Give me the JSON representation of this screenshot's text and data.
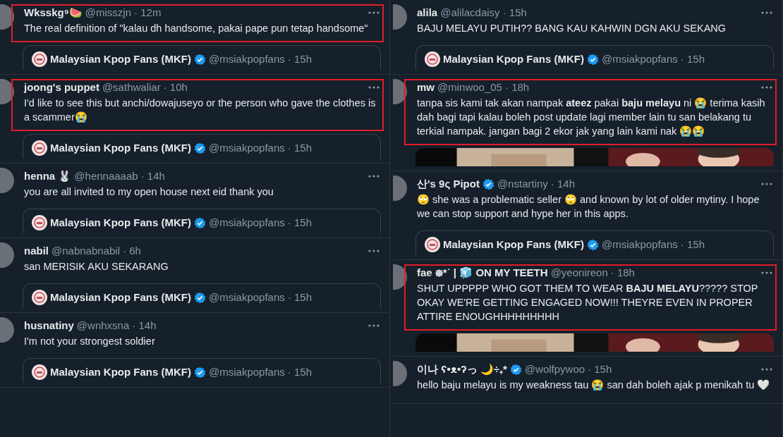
{
  "columns": [
    {
      "tweets": [
        {
          "name": "Wksskg⁹🍉",
          "verified": false,
          "handle": "@misszjn",
          "time": "· 12m",
          "text": "The real definition of \"kalau dh handsome, pakai pape pun tetap handsome\"",
          "highlighted": true,
          "quote": {
            "name": "Malaysian Kpop Fans (MKF)",
            "verified": true,
            "handle": "@msiakpopfans",
            "time": "· 15h"
          }
        },
        {
          "name": "joong's puppet",
          "verified": false,
          "handle": "@sathwaliar",
          "time": "· 10h",
          "text": "I'd like to see this but anchi/dowajuseyo or the person who gave the clothes is a scammer😭",
          "highlighted": true,
          "quote": {
            "name": "Malaysian Kpop Fans (MKF)",
            "verified": true,
            "handle": "@msiakpopfans",
            "time": "· 15h"
          }
        },
        {
          "name": "henna 🐰",
          "verified": false,
          "handle": "@hennaaaab",
          "time": "· 14h",
          "text": "you are all invited to my open house next eid thank you",
          "highlighted": false,
          "quote": {
            "name": "Malaysian Kpop Fans (MKF)",
            "verified": true,
            "handle": "@msiakpopfans",
            "time": "· 15h"
          }
        },
        {
          "name": "nabil",
          "verified": false,
          "handle": "@nabnabnabil",
          "time": "· 6h",
          "text": "san MERISIK AKU SEKARANG",
          "highlighted": false,
          "quote": {
            "name": "Malaysian Kpop Fans (MKF)",
            "verified": true,
            "handle": "@msiakpopfans",
            "time": "· 15h"
          }
        },
        {
          "name": "husnatiny",
          "verified": false,
          "handle": "@wnhxsna",
          "time": "· 14h",
          "text": "I'm not your strongest soldier",
          "highlighted": false,
          "quote": {
            "name": "Malaysian Kpop Fans (MKF)",
            "verified": true,
            "handle": "@msiakpopfans",
            "time": "· 15h"
          }
        }
      ]
    },
    {
      "tweets": [
        {
          "name": "alila",
          "verified": false,
          "handle": "@alilacdaisy",
          "time": "· 15h",
          "text": "BAJU MELAYU PUTIH?? BANG KAU KAHWIN DGN AKU SEKANG",
          "highlighted": false,
          "quote": {
            "name": "Malaysian Kpop Fans (MKF)",
            "verified": true,
            "handle": "@msiakpopfans",
            "time": "· 15h"
          }
        },
        {
          "name": "mw",
          "verified": false,
          "handle": "@minwoo_05",
          "time": "· 18h",
          "text": "tanpa sis kami tak akan nampak **ateez** pakai **baju melayu** ni 😭 terima kasih dah bagi tapi kalau boleh post update lagi member lain tu san belakang tu terkial nampak. jangan bagi 2 ekor jak yang lain kami nak 😭😭",
          "highlighted": true,
          "media": true
        },
        {
          "name": "산's 9ς Pipot",
          "verified": true,
          "handle": "@nstartiny",
          "time": "· 14h",
          "text": "🙄 she was a problematic seller 🙄 and known by lot of older mytiny. I hope we can stop support and hype her in this apps.",
          "highlighted": false,
          "quote": {
            "name": "Malaysian Kpop Fans (MKF)",
            "verified": true,
            "handle": "@msiakpopfans",
            "time": "· 15h"
          }
        },
        {
          "name": "fae ᪥*˙ | 🧊 ON MY TEETH",
          "verified": false,
          "handle": "@yeonireon",
          "time": "· 18h",
          "text": "SHUT UPPPPP WHO GOT THEM TO WEAR **BAJU MELAYU**????? STOP OKAY WE'RE GETTING ENGAGED NOW!!! THEYRE EVEN IN PROPER ATTIRE ENOUGHHHHHHHHH",
          "highlighted": true,
          "media": true
        },
        {
          "name": "이나 ʕ•ᴥ•ʔっ 🌙÷₊*",
          "verified": true,
          "handle": "@wolfpywoo",
          "time": "· 15h",
          "text": "hello baju melayu is my weakness tau 😭 san dah boleh ajak p menikah tu 🤍",
          "highlighted": false
        }
      ]
    }
  ]
}
